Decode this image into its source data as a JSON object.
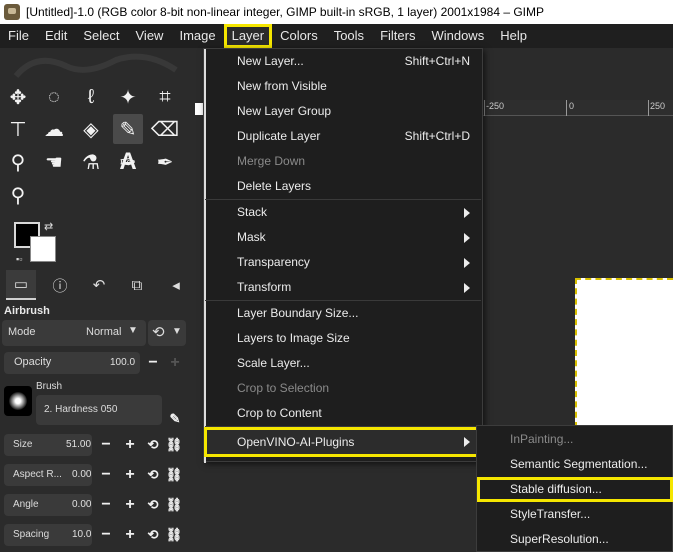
{
  "window": {
    "title": "[Untitled]-1.0 (RGB color 8-bit non-linear integer, GIMP built-in sRGB, 1 layer) 2001x1984 – GIMP"
  },
  "menubar": [
    "File",
    "Edit",
    "Select",
    "View",
    "Image",
    "Layer",
    "Colors",
    "Tools",
    "Filters",
    "Windows",
    "Help"
  ],
  "toolbox": {
    "panel_title": "Airbrush",
    "mode_label": "Mode",
    "mode_value": "Normal",
    "opacity_label": "Opacity",
    "opacity_value": "100.0",
    "brush_label": "Brush",
    "brush_value": "2. Hardness 050",
    "size_label": "Size",
    "size_value": "51.00",
    "aspect_label": "Aspect R...",
    "aspect_value": "0.00",
    "angle_label": "Angle",
    "angle_value": "0.00",
    "spacing_label": "Spacing",
    "spacing_value": "10.0"
  },
  "ruler": {
    "labels": [
      "-250",
      "0",
      "250"
    ]
  },
  "layer_menu": {
    "items": [
      {
        "label": "New Layer...",
        "shortcut": "Shift+Ctrl+N"
      },
      {
        "label": "New from Visible",
        "shortcut": ""
      },
      {
        "label": "New Layer Group",
        "shortcut": ""
      },
      {
        "label": "Duplicate Layer",
        "shortcut": "Shift+Ctrl+D"
      },
      {
        "label": "Merge Down",
        "shortcut": ""
      },
      {
        "label": "Delete Layers",
        "shortcut": ""
      },
      {
        "label": "Stack"
      },
      {
        "label": "Mask"
      },
      {
        "label": "Transparency"
      },
      {
        "label": "Transform"
      },
      {
        "label": "Layer Boundary Size..."
      },
      {
        "label": "Layers to Image Size"
      },
      {
        "label": "Scale Layer..."
      },
      {
        "label": "Crop to Selection"
      },
      {
        "label": "Crop to Content"
      },
      {
        "label": "OpenVINO-AI-Plugins"
      }
    ]
  },
  "submenu": {
    "items": [
      "InPainting...",
      "Semantic Segmentation...",
      "Stable diffusion...",
      "StyleTransfer...",
      "SuperResolution..."
    ]
  },
  "colors": {
    "highlight": "#f5e600",
    "menu_bg": "#1e1e1e",
    "app_bg": "#2b2b2b"
  }
}
